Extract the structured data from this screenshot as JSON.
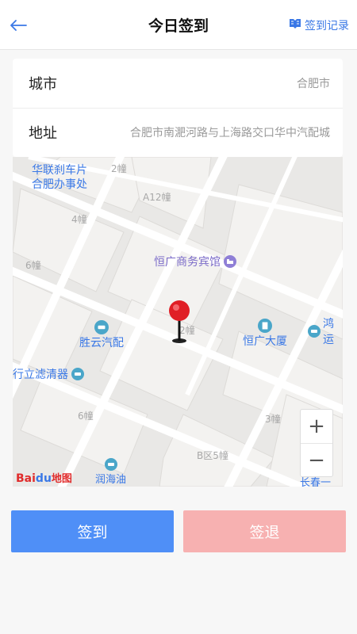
{
  "header": {
    "title": "今日签到",
    "history_label": "签到记录"
  },
  "form": {
    "city_label": "城市",
    "city_value": "合肥市",
    "address_label": "地址",
    "address_value": "合肥市南淝河路与上海路交口华中汽配城"
  },
  "map": {
    "labels": {
      "hualian1": "华联刹车片",
      "hualian2": "合肥办事处",
      "b2_top": "2幢",
      "a12": "A12幢",
      "b4": "4幢",
      "b6_left": "6幢",
      "hengguang_hotel": "恒广商务宾馆",
      "b2_center": "2幢",
      "hongyun": "鸿运",
      "shengyun": "胜云汽配",
      "hengguang_tower": "恒广大厦",
      "lvqingqi": "行立滤清器",
      "b6_bottom": "6幢",
      "b3": "3幢",
      "b5": "B区5幢",
      "runhaiyou": "润海油",
      "changchun": "长春一"
    },
    "zoom_in": "+",
    "zoom_out": "−",
    "logo_bai": "Bai",
    "logo_paw": "du",
    "logo_text": "地图"
  },
  "actions": {
    "checkin_label": "签到",
    "checkout_label": "签退"
  },
  "colors": {
    "accent": "#3a78e6",
    "checkin": "#4f8ff7",
    "checkout": "#f7b1b1",
    "pin": "#e01f26"
  }
}
